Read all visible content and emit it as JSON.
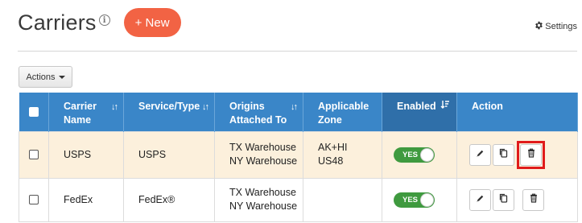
{
  "header": {
    "title": "Carriers",
    "new_button": "+ New",
    "settings_label": "Settings"
  },
  "toolbar": {
    "actions_label": "Actions"
  },
  "table": {
    "columns": [
      {
        "line1": "Carrier",
        "line2": "Name"
      },
      {
        "line1": "Service/Type",
        "line2": ""
      },
      {
        "line1": "Origins",
        "line2": "Attached To"
      },
      {
        "line1": "Applicable",
        "line2": "Zone"
      },
      {
        "line1": "Enabled",
        "line2": ""
      },
      {
        "line1": "Action",
        "line2": ""
      }
    ],
    "rows": [
      {
        "carrier": "USPS",
        "service": "USPS",
        "origins": [
          "TX Warehouse",
          "NY Warehouse"
        ],
        "zones": [
          "AK+HI",
          "US48"
        ],
        "enabled": "YES"
      },
      {
        "carrier": "FedEx",
        "service": "FedEx®",
        "origins": [
          "TX Warehouse",
          "NY Warehouse"
        ],
        "zones": [
          "",
          ""
        ],
        "enabled": "YES"
      }
    ]
  },
  "colors": {
    "accent_new": "#f26344",
    "table_header": "#3a86c8",
    "enabled_header": "#2f6fa9",
    "toggle_on": "#3f9a3f",
    "row_highlight": "#fcf0dc",
    "focus_box": "#e01b1b"
  },
  "icons": {
    "info": "info-icon",
    "settings": "gear-icon",
    "edit": "pencil-icon",
    "copy": "copy-icon",
    "delete": "trash-icon"
  }
}
